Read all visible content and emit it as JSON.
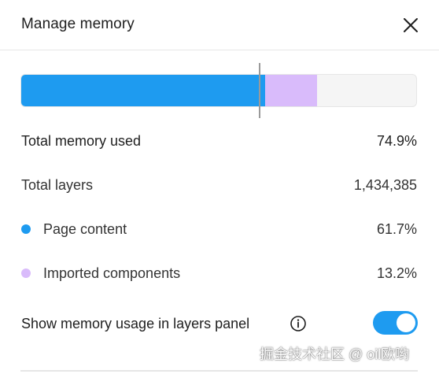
{
  "dialog": {
    "title": "Manage memory",
    "close_icon": "close-icon"
  },
  "memory_bar": {
    "segments": [
      {
        "name": "Page content",
        "fraction": 0.617,
        "color": "#1e9bf0"
      },
      {
        "name": "Imported components",
        "fraction": 0.132,
        "color": "#d9bbfb"
      }
    ],
    "track_color": "#f5f5f5",
    "marker_fraction": 0.6
  },
  "stats": {
    "total_memory_label": "Total memory used",
    "total_memory_value": "74.9%",
    "total_layers_label": "Total layers",
    "total_layers_value": "1,434,385",
    "page_content_label": "Page content",
    "page_content_value": "61.7%",
    "page_content_color": "#1e9bf0",
    "imported_label": "Imported components",
    "imported_value": "13.2%",
    "imported_color": "#d9bbfb"
  },
  "settings": {
    "show_usage_label": "Show memory usage in layers panel",
    "info_icon": "info-icon",
    "show_usage_enabled": true,
    "toggle_color": "#1e9bf0"
  },
  "watermark": {
    "text": "掘金技术社区 @ oil欧哟"
  }
}
